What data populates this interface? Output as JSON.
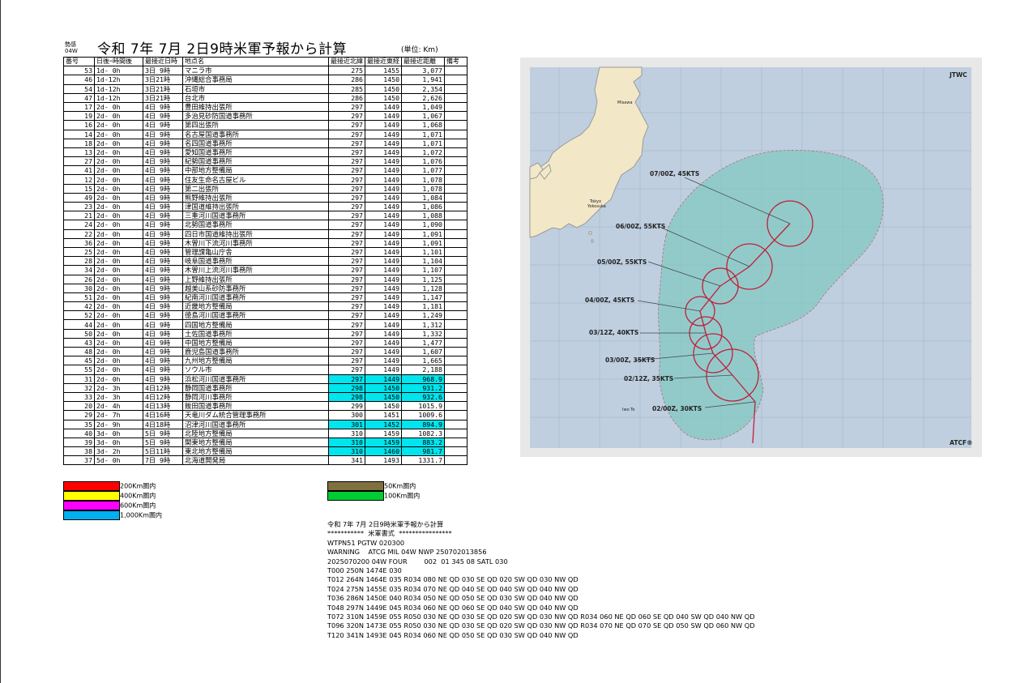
{
  "header": {
    "small_line1": "勢感",
    "small_line2": "04W",
    "title": "令和 7年 7月 2日9時米軍予報から計算",
    "unit": "(単位: Km)"
  },
  "table": {
    "headers": [
      "番号",
      "日後ｰ時間後",
      "最接近日時",
      "地点名",
      "最接近北緯",
      "最接近東経",
      "最接近距離",
      "備考"
    ],
    "rows": [
      [
        "53",
        "1d- 0h",
        "3日 9時",
        "マニラ市",
        "275",
        "1455",
        "3,077",
        ""
      ],
      [
        "46",
        "1d-12h",
        "3日21時",
        "沖縄総合事務局",
        "286",
        "1450",
        "1,941",
        ""
      ],
      [
        "54",
        "1d-12h",
        "3日21時",
        "石垣市",
        "285",
        "1450",
        "2,354",
        ""
      ],
      [
        "47",
        "1d-12h",
        "3日21時",
        "台北市",
        "286",
        "1450",
        "2,626",
        ""
      ],
      [
        "17",
        "2d- 0h",
        "4日 9時",
        "豊田維持出張所",
        "297",
        "1449",
        "1,049",
        ""
      ],
      [
        "19",
        "2d- 0h",
        "4日 9時",
        "多治見砂防国道事務所",
        "297",
        "1449",
        "1,067",
        ""
      ],
      [
        "16",
        "2d- 0h",
        "4日 9時",
        "第四出張所",
        "297",
        "1449",
        "1,068",
        ""
      ],
      [
        "14",
        "2d- 0h",
        "4日 9時",
        "名古屋国道事務所",
        "297",
        "1449",
        "1,071",
        ""
      ],
      [
        "18",
        "2d- 0h",
        "4日 9時",
        "名四国道事務所",
        "297",
        "1449",
        "1,071",
        ""
      ],
      [
        "13",
        "2d- 0h",
        "4日 9時",
        "愛知国道事務所",
        "297",
        "1449",
        "1,072",
        ""
      ],
      [
        "27",
        "2d- 0h",
        "4日 9時",
        "紀勢国道事務所",
        "297",
        "1449",
        "1,076",
        ""
      ],
      [
        "41",
        "2d- 0h",
        "4日 9時",
        "中部地方整備局",
        "297",
        "1449",
        "1,077",
        ""
      ],
      [
        "12",
        "2d- 0h",
        "4日 9時",
        "住友生命名古屋ビル",
        "297",
        "1449",
        "1,078",
        ""
      ],
      [
        "15",
        "2d- 0h",
        "4日 9時",
        "第二出張所",
        "297",
        "1449",
        "1,078",
        ""
      ],
      [
        "49",
        "2d- 0h",
        "4日 9時",
        "熊野維持出張所",
        "297",
        "1449",
        "1,084",
        ""
      ],
      [
        "23",
        "2d- 0h",
        "4日 9時",
        "津国道維持出張所",
        "297",
        "1449",
        "1,086",
        ""
      ],
      [
        "21",
        "2d- 0h",
        "4日 9時",
        "三重河川国道事務所",
        "297",
        "1449",
        "1,088",
        ""
      ],
      [
        "24",
        "2d- 0h",
        "4日 9時",
        "北勢国道事務所",
        "297",
        "1449",
        "1,090",
        ""
      ],
      [
        "22",
        "2d- 0h",
        "4日 9時",
        "四日市国道維持出張所",
        "297",
        "1449",
        "1,091",
        ""
      ],
      [
        "36",
        "2d- 0h",
        "4日 9時",
        "木曽川下流河川事務所",
        "297",
        "1449",
        "1,091",
        ""
      ],
      [
        "25",
        "2d- 0h",
        "4日 9時",
        "管理課亀山庁舎",
        "297",
        "1449",
        "1,101",
        ""
      ],
      [
        "28",
        "2d- 0h",
        "4日 9時",
        "岐阜国道事務所",
        "297",
        "1449",
        "1,104",
        ""
      ],
      [
        "34",
        "2d- 0h",
        "4日 9時",
        "木曽川上流河川事務所",
        "297",
        "1449",
        "1,107",
        ""
      ],
      [
        "26",
        "2d- 0h",
        "4日 9時",
        "上野維持出張所",
        "297",
        "1449",
        "1,125",
        ""
      ],
      [
        "30",
        "2d- 0h",
        "4日 9時",
        "越美山系砂防事務所",
        "297",
        "1449",
        "1,128",
        ""
      ],
      [
        "51",
        "2d- 0h",
        "4日 9時",
        "紀南河川国道事務所",
        "297",
        "1449",
        "1,147",
        ""
      ],
      [
        "42",
        "2d- 0h",
        "4日 9時",
        "近畿地方整備局",
        "297",
        "1449",
        "1,181",
        ""
      ],
      [
        "52",
        "2d- 0h",
        "4日 9時",
        "徳島河川国道事務所",
        "297",
        "1449",
        "1,249",
        ""
      ],
      [
        "44",
        "2d- 0h",
        "4日 9時",
        "四国地方整備局",
        "297",
        "1449",
        "1,312",
        ""
      ],
      [
        "50",
        "2d- 0h",
        "4日 9時",
        "土佐国道事務所",
        "297",
        "1449",
        "1,332",
        ""
      ],
      [
        "43",
        "2d- 0h",
        "4日 9時",
        "中国地方整備局",
        "297",
        "1449",
        "1,477",
        ""
      ],
      [
        "48",
        "2d- 0h",
        "4日 9時",
        "鹿児島国道事務所",
        "297",
        "1449",
        "1,607",
        ""
      ],
      [
        "45",
        "2d- 0h",
        "4日 9時",
        "九州地方整備局",
        "297",
        "1449",
        "1,665",
        ""
      ],
      [
        "55",
        "2d- 0h",
        "4日 9時",
        "ソウル市",
        "297",
        "1449",
        "2,188",
        ""
      ],
      [
        "31",
        "2d- 0h",
        "4日 9時",
        "浜松河川国道事務所",
        "297",
        "1449",
        "968.9",
        ""
      ],
      [
        "32",
        "2d- 3h",
        "4日12時",
        "静岡国道事務所",
        "298",
        "1450",
        "931.2",
        ""
      ],
      [
        "33",
        "2d- 3h",
        "4日12時",
        "静岡河川事務所",
        "298",
        "1450",
        "932.6",
        ""
      ],
      [
        "20",
        "2d- 4h",
        "4日13時",
        "飯田国道事務所",
        "299",
        "1450",
        "1015.9",
        ""
      ],
      [
        "29",
        "2d- 7h",
        "4日16時",
        "天竜川ダム統合管理事務所",
        "300",
        "1451",
        "1009.6",
        ""
      ],
      [
        "35",
        "2d- 9h",
        "4日18時",
        "沼津河川国道事務所",
        "301",
        "1452",
        "894.9",
        ""
      ],
      [
        "40",
        "3d- 0h",
        "5日 9時",
        "北陸地方整備局",
        "310",
        "1459",
        "1082.3",
        ""
      ],
      [
        "39",
        "3d- 0h",
        "5日 9時",
        "関東地方整備局",
        "310",
        "1459",
        "883.2",
        ""
      ],
      [
        "38",
        "3d- 2h",
        "5日11時",
        "東北地方整備局",
        "310",
        "1460",
        "981.7",
        ""
      ],
      [
        "37",
        "5d- 0h",
        "7日 9時",
        "北海道開発局",
        "341",
        "1493",
        "1331.7",
        ""
      ]
    ],
    "highlight_rows": [
      34,
      35,
      36,
      39,
      41,
      42
    ],
    "highlight_color": "#00e5ee"
  },
  "legend": [
    {
      "color": "#ff0000",
      "label": "200Km圏内"
    },
    {
      "color": "#ffff00",
      "label": "400Km圏内"
    },
    {
      "color": "#ff00ff",
      "label": "600Km圏内"
    },
    {
      "color": "#00b0f0",
      "label": "1,000Km圏内"
    }
  ],
  "legend2": [
    {
      "color": "#7f7040",
      "label": "50Km圏内"
    },
    {
      "color": "#00cc33",
      "label": "100Km圏内"
    }
  ],
  "message": {
    "lines": [
      "令和 7年 7月 2日9時米軍予報から計算",
      "***********  米軍書式  ****************",
      "WTPN51 PGTW 020300",
      "WARNING    ATCG MIL 04W NWP 250702013856",
      "2025070200 04W FOUR        002  01 345 08 SATL 030",
      "T000 250N 1474E 030",
      "T012 264N 1464E 035 R034 080 NE QD 030 SE QD 020 SW QD 030 NW QD",
      "T024 275N 1455E 035 R034 070 NE QD 040 SE QD 040 SW QD 040 NW QD",
      "T036 286N 1450E 040 R034 050 NE QD 050 SE QD 030 SW QD 040 NW QD",
      "T048 297N 1449E 045 R034 060 NE QD 060 SE QD 040 SW QD 040 NW QD",
      "T072 310N 1459E 055 R050 030 NE QD 030 SE QD 020 SW QD 030 NW QD R034 060 NE QD 060 SE QD 040 SW QD 040 NW QD",
      "T096 320N 1473E 055 R050 030 NE QD 030 SE QD 020 SW QD 030 NW QD R034 070 NE QD 070 SE QD 050 SW QD 060 NW QD",
      "T120 341N 1493E 045 R034 060 NE QD 050 SE QD 030 SW QD 040 NW QD"
    ]
  },
  "map": {
    "corner_top": "JTWC",
    "corner_bottom": "ATCF®",
    "sea_color": "#bfcfe0",
    "land_color": "#f2e8c8",
    "swath_color": "#7fc7c0",
    "track_color": "#c0203a",
    "place_misawa": "Misawa",
    "place_tokyo": "Tokyo",
    "place_yokosuka": "Yokosuka",
    "place_iwo": "Iwo To",
    "labels": [
      "07/00Z, 45KTS",
      "06/00Z, 55KTS",
      "05/00Z, 55KTS",
      "04/00Z, 45KTS",
      "03/12Z, 40KTS",
      "03/00Z, 35KTS",
      "02/12Z, 35KTS",
      "02/00Z, 30KTS"
    ]
  }
}
